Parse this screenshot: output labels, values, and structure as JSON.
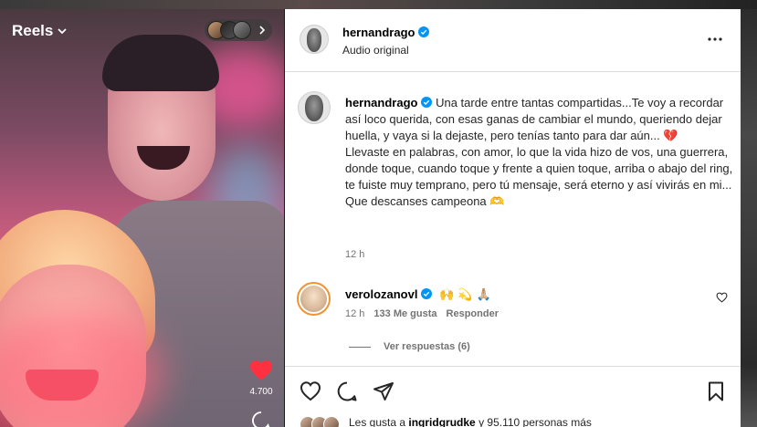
{
  "reels": {
    "title": "Reels",
    "like_count": "4.700"
  },
  "post": {
    "username": "hernandrago",
    "audio": "Audio original"
  },
  "caption": {
    "username": "hernandrago",
    "line1": "Una tarde entre tantas compartidas...Te voy a recordar así loco querida, con esas ganas de cambiar el mundo, queriendo dejar huella, y vaya si la dejaste, pero tenías tanto para dar aún...",
    "line1_emoji": "💔",
    "line2": "Llevaste en palabras, con amor, lo que la vida hizo de vos, una guerrera, donde toque, cuando toque y frente a quien toque, arriba o abajo del ring, te fuiste muy temprano, pero tú mensaje, será eterno y así vivirás en mi...",
    "line3": "Que descanses campeona",
    "line3_emoji": "🫶",
    "time": "12 h"
  },
  "comment": {
    "username": "verolozanovl",
    "text": "🙌 💫 🙏🏼",
    "time": "12 h",
    "likes": "133 Me gusta",
    "reply": "Responder",
    "view_replies": "Ver respuestas (6)"
  },
  "likes_summary": {
    "prefix": "Les gusta a",
    "user": "ingridgrudke",
    "suffix": "y 95.110 personas más"
  },
  "colors": {
    "verified": "#0095f6",
    "heart": "#ff3040",
    "text": "#262626",
    "muted": "#737373"
  },
  "icons": [
    "chevron-down-icon",
    "chevron-right-icon",
    "heart-icon",
    "comment-icon",
    "more-icon",
    "verified-icon",
    "share-icon",
    "bookmark-icon"
  ]
}
